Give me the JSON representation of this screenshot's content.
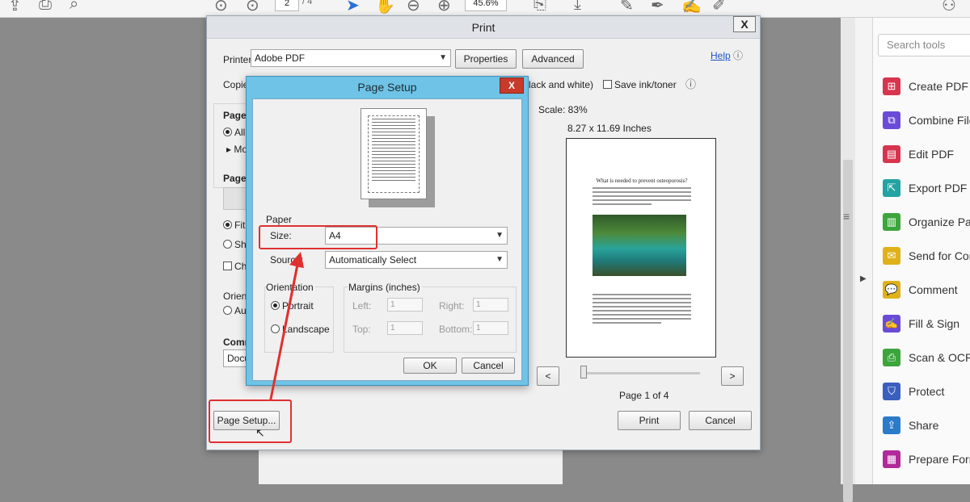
{
  "toolbar": {
    "page_current": "2",
    "page_total": "/ 4",
    "zoom": "45.6%"
  },
  "print": {
    "title": "Print",
    "close": "X",
    "printer_label": "Printer:",
    "printer_value": "Adobe PDF",
    "properties_btn": "Properties",
    "advanced_btn": "Advanced",
    "help_link": "Help",
    "copies_label": "Copies",
    "color_partial": "lack and white)",
    "save_ink_label": "Save ink/toner",
    "pages_label": "Pages",
    "all_label": "All",
    "more_label": "Mo",
    "page_sizing_label": "Page S",
    "fit_label": "Fit",
    "shrink_label": "Shr",
    "choose_label": "Cho",
    "orient_label": "Orient",
    "auto_label": "Aut",
    "comments_label": "Comm",
    "doc_value": "Docu",
    "scale_text": "Scale:  83%",
    "dims_text": "8.27 x 11.69 Inches",
    "preview_title": "What is needed to prevent osteoporosis?",
    "page_of": "Page 1 of 4",
    "prev_btn": "<",
    "next_btn": ">",
    "page_setup_btn": "Page Setup...",
    "print_btn": "Print",
    "cancel_btn": "Cancel"
  },
  "page_setup": {
    "title": "Page Setup",
    "close": "X",
    "paper_label": "Paper",
    "size_label": "Size:",
    "size_value": "A4",
    "source_label": "Source:",
    "source_value": "Automatically Select",
    "orientation_label": "Orientation",
    "portrait_label": "Portrait",
    "landscape_label": "Landscape",
    "margins_label": "Margins (inches)",
    "left_label": "Left:",
    "right_label": "Right:",
    "top_label": "Top:",
    "bottom_label": "Bottom:",
    "left_value": "1",
    "right_value": "1",
    "top_value": "1",
    "bottom_value": "1",
    "ok_btn": "OK",
    "cancel_btn": "Cancel"
  },
  "tools": {
    "search_placeholder": "Search tools",
    "items": [
      {
        "label": "Create PDF",
        "icon": "create-pdf-icon",
        "color": "#d8344d"
      },
      {
        "label": "Combine Files",
        "icon": "combine-files-icon",
        "color": "#6a4bd8"
      },
      {
        "label": "Edit PDF",
        "icon": "edit-pdf-icon",
        "color": "#d8344d"
      },
      {
        "label": "Export PDF",
        "icon": "export-pdf-icon",
        "color": "#23a3a3"
      },
      {
        "label": "Organize Pages",
        "icon": "organize-pages-icon",
        "color": "#3ca53c"
      },
      {
        "label": "Send for Comments",
        "icon": "send-comments-icon",
        "color": "#e0b21a"
      },
      {
        "label": "Comment",
        "icon": "comment-icon",
        "color": "#e0b21a"
      },
      {
        "label": "Fill & Sign",
        "icon": "fill-sign-icon",
        "color": "#6a4bd8"
      },
      {
        "label": "Scan & OCR",
        "icon": "scan-ocr-icon",
        "color": "#3ca53c"
      },
      {
        "label": "Protect",
        "icon": "protect-icon",
        "color": "#3a5fbf"
      },
      {
        "label": "Share",
        "icon": "share-icon",
        "color": "#2a7bc9"
      },
      {
        "label": "Prepare Form",
        "icon": "prepare-form-icon",
        "color": "#b02a9a"
      }
    ]
  }
}
